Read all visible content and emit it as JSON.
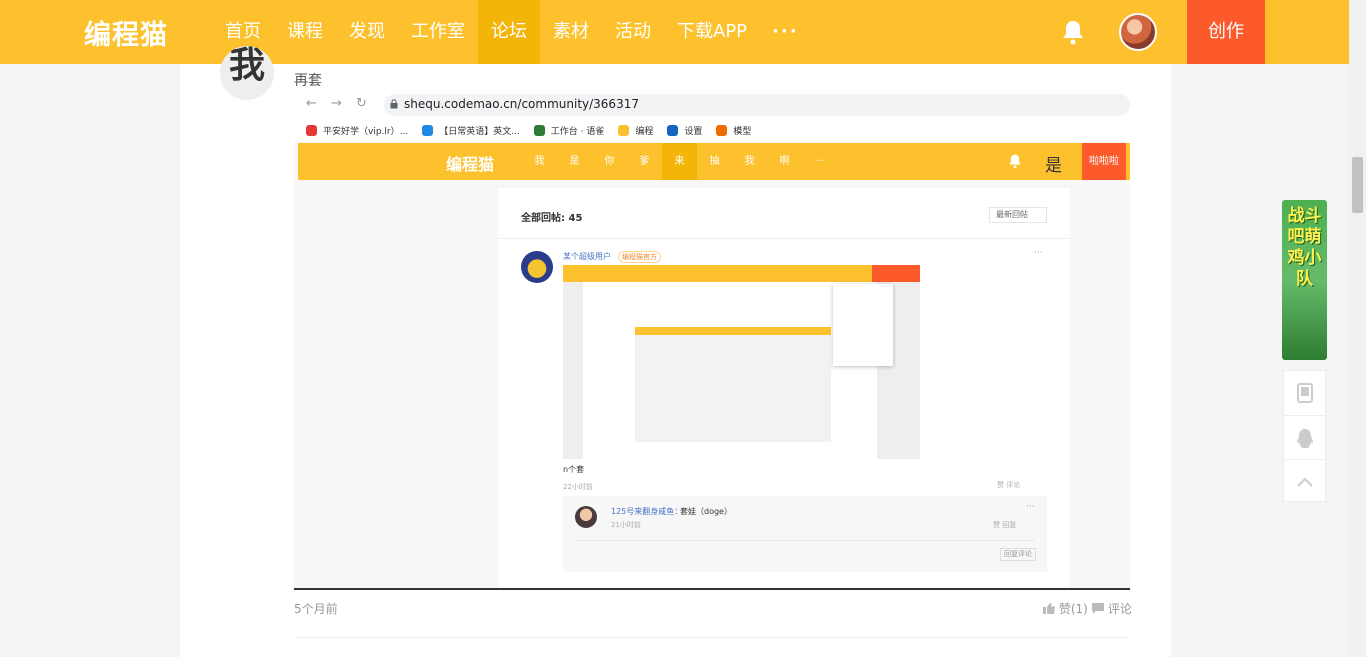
{
  "header": {
    "logo": "编程猫",
    "nav": [
      "首页",
      "课程",
      "发现",
      "工作室",
      "论坛",
      "素材",
      "活动",
      "下载APP"
    ],
    "more": "···",
    "create_label": "创作"
  },
  "post": {
    "avatar_text": "我",
    "title": "再套",
    "time": "5个月前",
    "like_label": "赞(1)",
    "comment_label": "评论"
  },
  "screenshot": {
    "url": "shequ.codemao.cn/community/366317",
    "bookmarks": [
      {
        "label": "平安好学（vip.lr）...",
        "color": "#e53935"
      },
      {
        "label": "【日常英语】英文...",
        "color": "#1e88e5"
      },
      {
        "label": "工作台 · 语雀",
        "color": "#2e7d32"
      },
      {
        "label": "编程",
        "color": "#fbc02d"
      },
      {
        "label": "设置",
        "color": "#1565c0"
      },
      {
        "label": "模型",
        "color": "#ef6c00"
      }
    ],
    "inner_nav": {
      "logo": "编程猫",
      "items": [
        "我",
        "是",
        "你",
        "爹",
        "来",
        "抽",
        "我",
        "啊",
        "···"
      ],
      "active_index": 4,
      "right_char": "是",
      "red_label": "啦啦啦"
    },
    "reply_count": "全部回帖: 45",
    "sort_label": "最新回帖",
    "comment": {
      "user": "某个超级用户",
      "badge": "编程猫官方",
      "text": "n个套",
      "time": "22小时前",
      "actions": "赞  评论"
    },
    "reply": {
      "user": "125号来翻身咸鱼：",
      "text": "套娃（doge）",
      "time": "21小时前",
      "actions": "赞  回复",
      "button": "回复评论"
    }
  },
  "colors": {
    "brand": "#fcc12d",
    "brand_active": "#f2b508",
    "create": "#fc5a2a"
  },
  "promo": {
    "text": "战斗吧萌鸡小队"
  }
}
